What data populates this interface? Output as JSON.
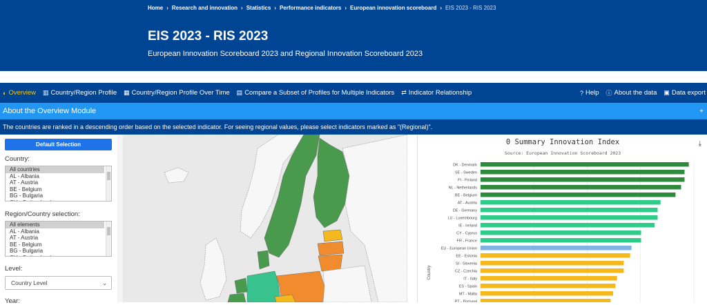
{
  "breadcrumb": [
    "Home",
    "Research and innovation",
    "Statistics",
    "Performance indicators",
    "European innovation scoreboard",
    "EIS 2023 - RIS 2023"
  ],
  "header": {
    "title": "EIS 2023 - RIS 2023",
    "subtitle": "European Innovation Scoreboard 2023 and Regional Innovation Scoreboard 2023"
  },
  "nav": {
    "items": [
      {
        "label": "Overview",
        "icon": "compass-icon",
        "active": true
      },
      {
        "label": "Country/Region Profile",
        "icon": "bank-icon"
      },
      {
        "label": "Country/Region Profile Over Time",
        "icon": "calendar-icon"
      },
      {
        "label": "Compare a Subset of Profiles for Multiple Indicators",
        "icon": "chart-icon"
      },
      {
        "label": "Indicator Relationship",
        "icon": "exchange-icon"
      }
    ],
    "right_items": [
      {
        "label": "Help",
        "icon": "question-icon"
      },
      {
        "label": "About the data",
        "icon": "info-icon"
      },
      {
        "label": "Data export",
        "icon": "database-icon"
      }
    ]
  },
  "about": {
    "label": "About the Overview Module",
    "toggle": "+"
  },
  "info_text": "The countries are ranked in a descending order based on the selected indicator. For seeing regional values, please select indicators marked as \"(Regional)\".",
  "sidebar": {
    "default_button": "Default Selection",
    "country_label": "Country:",
    "country_options": [
      "All countries",
      "AL - Albania",
      "AT - Austria",
      "BE - Belgium",
      "BG - Bulgaria",
      "CH - Switzerland"
    ],
    "region_label": "Region/Country selection:",
    "region_options": [
      "All elements",
      "AL - Albania",
      "AT - Austria",
      "BE - Belgium",
      "BG - Bulgaria",
      "CH - Switzerland"
    ],
    "level_label": "Level:",
    "level_value": "Country Level",
    "year_label": "Year:"
  },
  "colors": {
    "header_bg": "#004494",
    "about_bg": "#2196f3",
    "leader": "#2e8b3e",
    "strong": "#2ecc8a",
    "eu": "#7fb3e6",
    "moderate": "#f5b91e",
    "emerging": "#f08c2e"
  },
  "chart_data": {
    "type": "bar",
    "orientation": "horizontal",
    "title": "0 Summary Innovation Index",
    "subtitle": "Source: European Innovation Scoreboard 2023",
    "ylabel": "Country",
    "xlim": [
      0,
      0.8
    ],
    "categories": [
      "DK - Denmark",
      "SE - Sweden",
      "FI - Finland",
      "NL - Netherlands",
      "BE - Belgium",
      "AT - Austria",
      "DE - Germany",
      "LU - Luxembourg",
      "IE - Ireland",
      "CY - Cyprus",
      "FR - France",
      "EU - European Union",
      "EE - Estonia",
      "SI - Slovenia",
      "CZ - Czechia",
      "IT - Italy",
      "ES - Spain",
      "MT - Malta",
      "PT - Portugal"
    ],
    "values": [
      0.781,
      0.765,
      0.765,
      0.752,
      0.731,
      0.675,
      0.664,
      0.664,
      0.653,
      0.602,
      0.602,
      0.566,
      0.561,
      0.537,
      0.537,
      0.512,
      0.506,
      0.497,
      0.488
    ],
    "groups": [
      "leader",
      "leader",
      "leader",
      "leader",
      "leader",
      "strong",
      "strong",
      "strong",
      "strong",
      "strong",
      "strong",
      "eu",
      "moderate",
      "moderate",
      "moderate",
      "moderate",
      "moderate",
      "moderate",
      "moderate"
    ]
  }
}
